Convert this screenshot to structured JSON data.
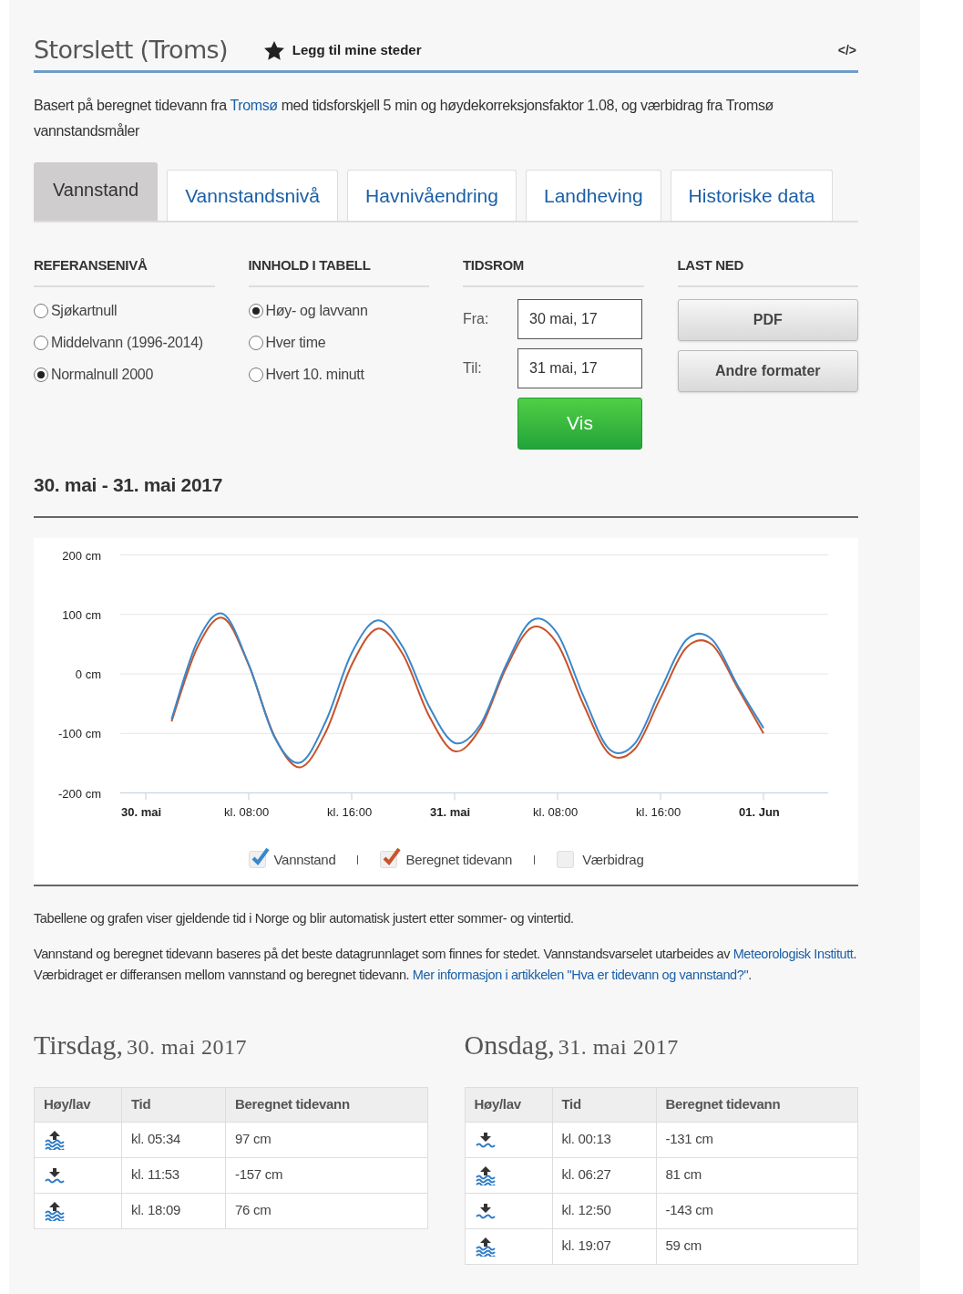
{
  "header": {
    "title": "Storslett (Troms)",
    "favorite": {
      "label": "Legg til mine steder"
    },
    "embed": "</>"
  },
  "intro": [
    {
      "text": "Basert på beregnet tidevann fra ",
      "link": false
    },
    {
      "text": "Tromsø",
      "link": true
    },
    {
      "text": " med tidsforskjell 5 min og høydekorreksjonsfaktor 1.08, og værbidrag fra Tromsø vannstandsmåler",
      "link": false
    }
  ],
  "tabs": [
    {
      "label": "Vannstand",
      "selected": true
    },
    {
      "label": "Vannstandsnivå",
      "selected": false
    },
    {
      "label": "Havnivåendring",
      "selected": false
    },
    {
      "label": "Landheving",
      "selected": false
    },
    {
      "label": "Historiske data",
      "selected": false
    }
  ],
  "reference_level": {
    "heading": "REFERANSENIVÅ",
    "options": [
      {
        "label": "Sjøkartnull",
        "selected": false
      },
      {
        "label": "Middelvann (1996-2014)",
        "selected": false
      },
      {
        "label": "Normalnull 2000",
        "selected": true
      }
    ]
  },
  "table_content": {
    "heading": "INNHOLD I TABELL",
    "options": [
      {
        "label": "Høy- og lavvann",
        "selected": true
      },
      {
        "label": "Hver time",
        "selected": false
      },
      {
        "label": "Hvert 10. minutt",
        "selected": false
      }
    ]
  },
  "period": {
    "heading": "TIDSROM",
    "from_label": "Fra:",
    "from_value": "30 mai, 17",
    "to_label": "Til:",
    "to_value": "31 mai, 17",
    "button": "Vis"
  },
  "download": {
    "heading": "LAST NED",
    "buttons": [
      "PDF",
      "Andre formater"
    ]
  },
  "chart_title": "30. mai - 31. mai 2017",
  "chart": {
    "chart_data": {
      "type": "line",
      "categories": [
        "30. mai",
        null,
        null,
        null,
        "kl. 08:00",
        null,
        null,
        null,
        "kl. 16:00",
        null,
        null,
        null,
        "31. mai",
        null,
        null,
        null,
        "kl. 08:00",
        null,
        null,
        null,
        "kl. 16:00",
        null,
        null,
        null,
        "01. Jun"
      ],
      "series": [
        {
          "name": "Vannstand",
          "color": "#3a87cc",
          "values": [
            null,
            -76,
            54,
            101,
            16,
            -106,
            -149,
            -79,
            35,
            90,
            44,
            -54,
            -116,
            -85,
            15,
            90,
            67,
            -37,
            -126,
            -117,
            -27,
            57,
            58,
            -20,
            -91
          ]
        },
        {
          "name": "Beregnet tidevann",
          "color": "#c9532a",
          "values": [
            null,
            -80,
            44,
            94,
            15,
            -105,
            -157,
            -97,
            15,
            76,
            32,
            -70,
            -130,
            -91,
            10,
            78,
            50,
            -51,
            -134,
            -126,
            -40,
            44,
            49,
            -24,
            -100
          ]
        }
      ],
      "ylim": [
        -200,
        200
      ],
      "yticks": [
        {
          "value": 200,
          "label": "200 cm"
        },
        {
          "value": 100,
          "label": "100 cm"
        },
        {
          "value": 0,
          "label": "0 cm"
        },
        {
          "value": -100,
          "label": "-100 cm"
        },
        {
          "value": -200,
          "label": "-200 cm"
        }
      ],
      "grid": true,
      "legend": "bottom"
    },
    "legend": [
      {
        "checked": true
      },
      {
        "checked": true
      },
      {
        "label": "Værbidrag",
        "checked": false
      }
    ]
  },
  "notes": [
    [
      {
        "text": "Tabellene og grafen viser gjeldende tid i Norge og blir automatisk justert etter sommer- og vintertid.",
        "link": false
      }
    ],
    [
      {
        "text": "Vannstand og beregnet tidevann baseres på det beste datagrunnlaget som finnes for stedet. Vannstandsvarselet utarbeides av ",
        "link": false
      },
      {
        "text": "Meteorologisk Institutt",
        "link": true
      },
      {
        "text": ". Værbidraget er differansen mellom vannstand og beregnet tidevann. ",
        "link": false
      },
      {
        "text": "Mer informasjon i artikkelen \"Hva er tidevann og vannstand?\"",
        "link": true
      },
      {
        "text": ".",
        "link": false
      }
    ]
  ],
  "days": [
    {
      "weekday": "Tirsdag,",
      "date": "30. mai 2017",
      "columns": [
        "Høy/lav",
        "Tid",
        "Beregnet tidevann"
      ],
      "rows": [
        {
          "kind": "high",
          "time": "kl. 05:34",
          "value": "97 cm"
        },
        {
          "kind": "low",
          "time": "kl. 11:53",
          "value": "-157 cm"
        },
        {
          "kind": "high",
          "time": "kl. 18:09",
          "value": "76 cm"
        }
      ]
    },
    {
      "weekday": "Onsdag,",
      "date": "31. mai 2017",
      "columns": [
        "Høy/lav",
        "Tid",
        "Beregnet tidevann"
      ],
      "rows": [
        {
          "kind": "low",
          "time": "kl. 00:13",
          "value": "-131 cm"
        },
        {
          "kind": "high",
          "time": "kl. 06:27",
          "value": "81 cm"
        },
        {
          "kind": "low",
          "time": "kl. 12:50",
          "value": "-143 cm"
        },
        {
          "kind": "high",
          "time": "kl. 19:07",
          "value": "59 cm"
        }
      ]
    }
  ]
}
